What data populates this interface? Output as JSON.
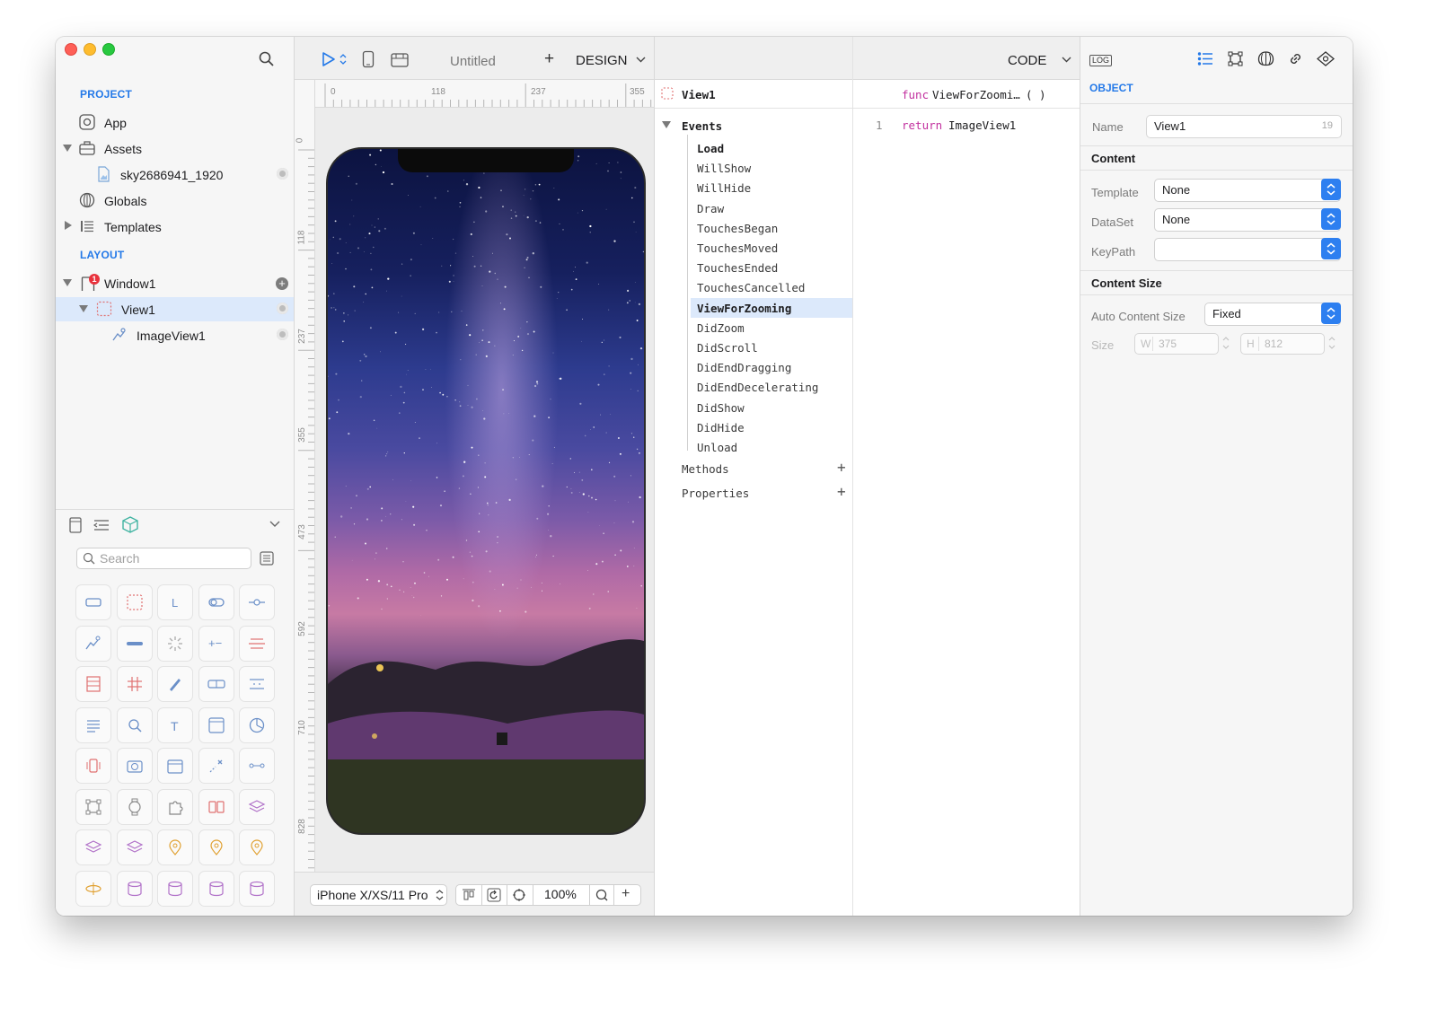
{
  "sidebar": {
    "project_title": "PROJECT",
    "layout_title": "LAYOUT",
    "project_items": [
      {
        "label": "App",
        "icon": "app-icon"
      },
      {
        "label": "Assets",
        "icon": "briefcase-icon"
      },
      {
        "label": "sky2686941_1920",
        "icon": "image-file-icon"
      },
      {
        "label": "Globals",
        "icon": "globe-icon"
      },
      {
        "label": "Templates",
        "icon": "list-icon"
      }
    ],
    "layout_items": [
      {
        "label": "Window1",
        "icon": "window-icon",
        "badge": "1"
      },
      {
        "label": "View1",
        "icon": "view-icon"
      },
      {
        "label": "ImageView1",
        "icon": "image-view-icon"
      }
    ],
    "search_placeholder": "Search"
  },
  "toolbar": {
    "doc_title": "Untitled",
    "add_label": "+",
    "design_label": "DESIGN",
    "code_label": "CODE"
  },
  "ruler": {
    "h_ticks": [
      "0",
      "118",
      "237",
      "355"
    ],
    "v_ticks": [
      "0",
      "118",
      "237",
      "355",
      "473",
      "592",
      "710",
      "828"
    ]
  },
  "canvas_bottom": {
    "device": "iPhone X/XS/11 Pro",
    "zoom": "100%",
    "zoom_in": "+"
  },
  "events_panel": {
    "object_name": "View1",
    "events_label": "Events",
    "events": [
      "Load",
      "WillShow",
      "WillHide",
      "Draw",
      "TouchesBegan",
      "TouchesMoved",
      "TouchesEnded",
      "TouchesCancelled",
      "ViewForZooming",
      "DidZoom",
      "DidScroll",
      "DidEndDragging",
      "DidEndDecelerating",
      "DidShow",
      "DidHide",
      "Unload"
    ],
    "selected_event": "ViewForZooming",
    "methods_label": "Methods",
    "properties_label": "Properties",
    "plus": "+"
  },
  "code_panel": {
    "func_keyword": "func",
    "func_name": "ViewForZoomi…",
    "func_parens": "( )",
    "line_no": "1",
    "return_keyword": "return",
    "return_value": "ImageView1"
  },
  "inspector": {
    "log_label": "LOG",
    "object_title": "OBJECT",
    "name_label": "Name",
    "name_value": "View1",
    "name_count": "19",
    "content_title": "Content",
    "template_label": "Template",
    "template_value": "None",
    "dataset_label": "DataSet",
    "dataset_value": "None",
    "keypath_label": "KeyPath",
    "keypath_value": "",
    "content_size_title": "Content Size",
    "auto_size_label": "Auto Content Size",
    "auto_size_value": "Fixed",
    "size_label": "Size",
    "w_label": "W",
    "w_value": "375",
    "h_label": "H",
    "h_value": "812"
  },
  "colors": {
    "accent": "#2479e8",
    "selection": "#dce9fb",
    "keyword": "#c2309e",
    "stepper": "#2d7ff0"
  }
}
